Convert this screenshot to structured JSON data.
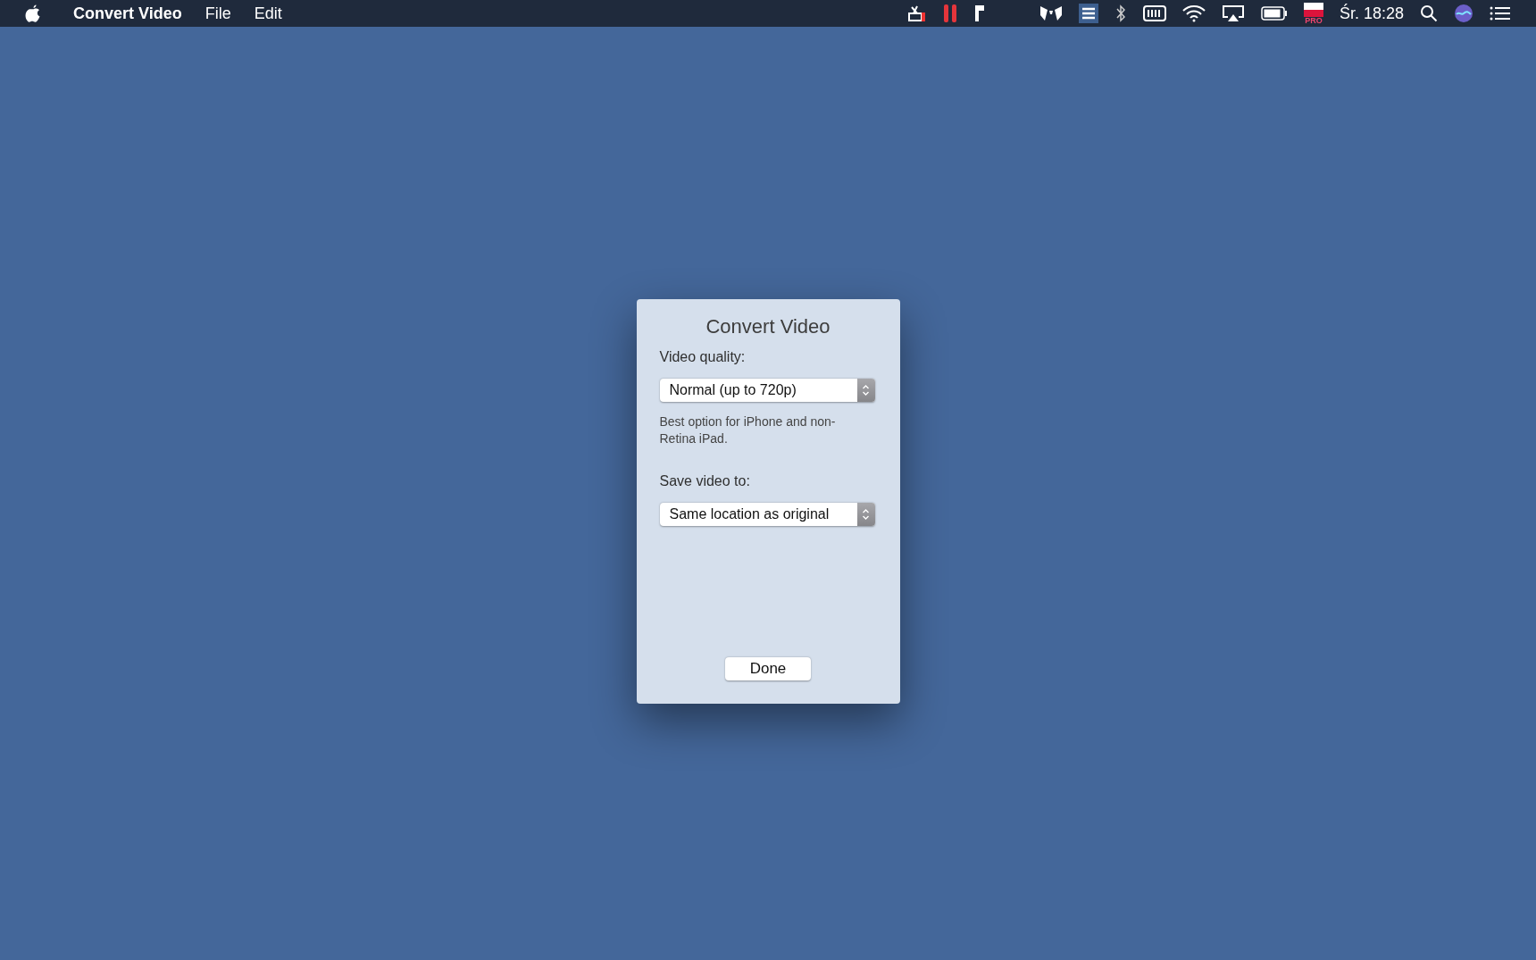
{
  "menu_bar": {
    "app_name": "Convert Video",
    "menus": [
      "File",
      "Edit"
    ],
    "status_flag_badge": "PRO",
    "clock": "Śr. 18:28"
  },
  "dialog": {
    "title": "Convert Video",
    "fields": [
      {
        "label": "Video quality:",
        "value": "Normal (up to 720p)",
        "hint": "Best option for iPhone and non-Retina iPad."
      },
      {
        "label": "Save video to:",
        "value": "Same location as original"
      }
    ],
    "button": "Done"
  }
}
